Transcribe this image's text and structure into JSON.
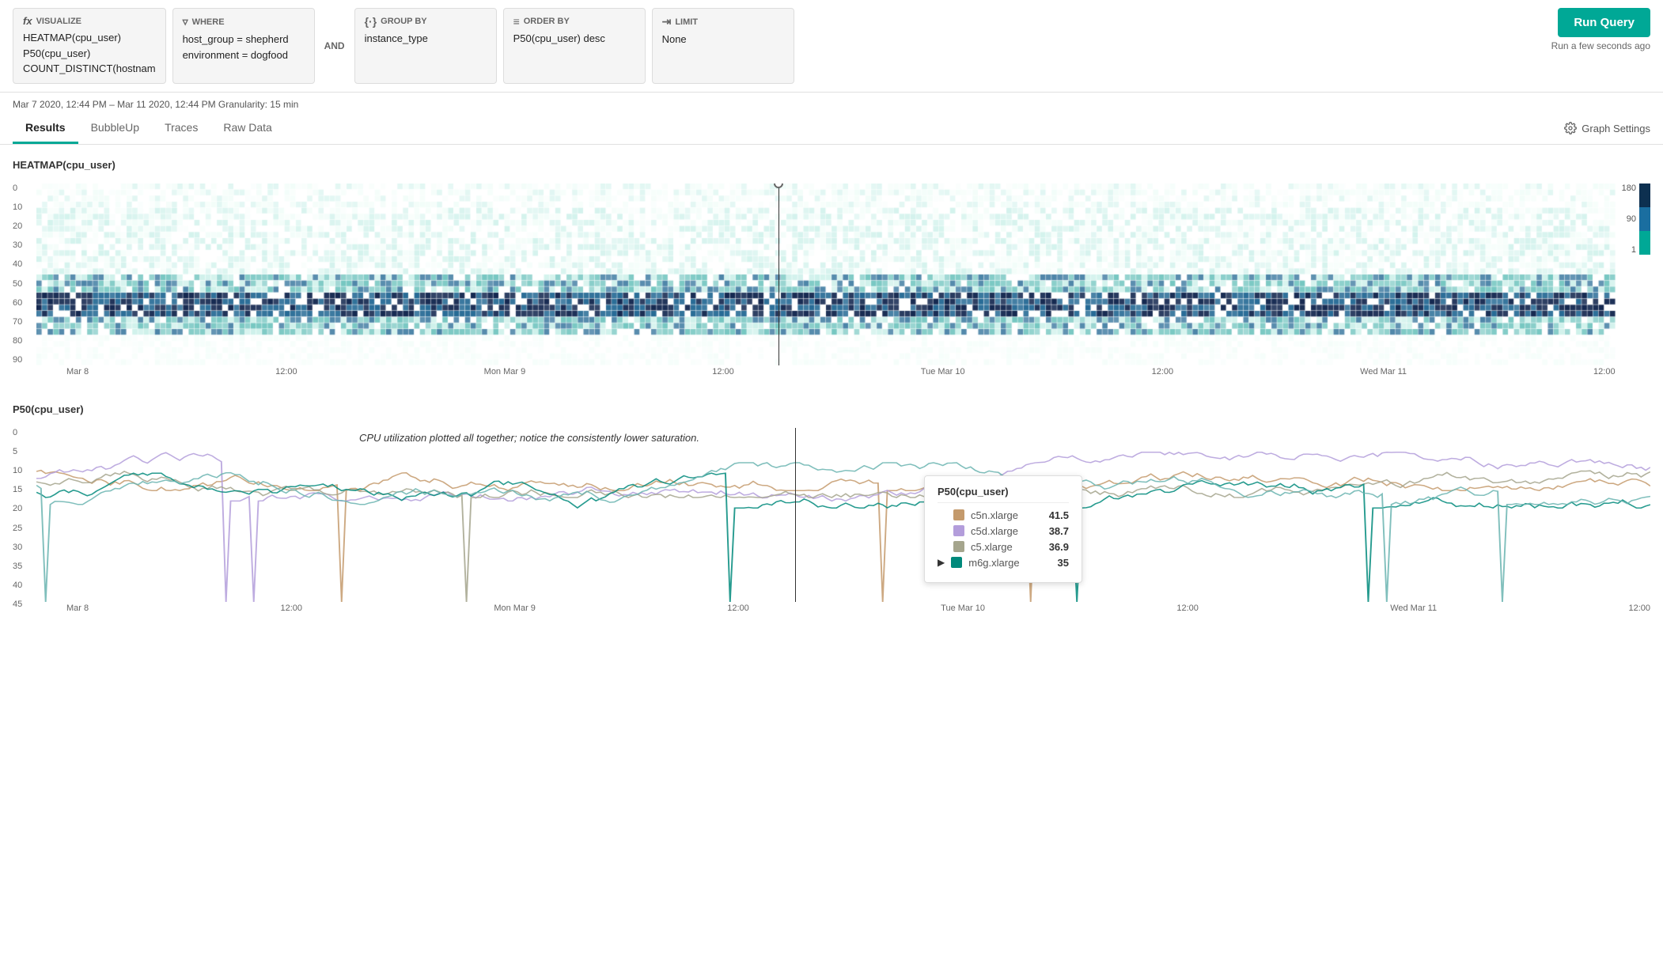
{
  "topbar": {
    "visualize_label": "VISUALIZE",
    "visualize_content_line1": "HEATMAP(cpu_user)",
    "visualize_content_line2": "P50(cpu_user)",
    "visualize_content_line3": "COUNT_DISTINCT(hostnam",
    "where_label": "WHERE",
    "and_label": "AND",
    "where_content_line1": "host_group = shepherd",
    "where_content_line2": "environment = dogfood",
    "group_by_label": "GROUP BY",
    "group_by_content": "instance_type",
    "order_by_label": "ORDER BY",
    "order_by_content": "P50(cpu_user) desc",
    "limit_label": "LIMIT",
    "limit_content": "None",
    "run_button_label": "Run Query",
    "run_ago_label": "Run a few seconds ago"
  },
  "timerange": {
    "text": "Mar 7 2020, 12:44 PM – Mar 11 2020, 12:44 PM  Granularity: 15 min"
  },
  "tabs": [
    {
      "label": "Results",
      "active": true
    },
    {
      "label": "BubbleUp",
      "active": false
    },
    {
      "label": "Traces",
      "active": false
    },
    {
      "label": "Raw Data",
      "active": false
    }
  ],
  "graph_settings_label": "Graph Settings",
  "heatmap": {
    "title": "HEATMAP(cpu_user)",
    "y_axis": [
      "0",
      "10",
      "20",
      "30",
      "40",
      "50",
      "60",
      "70",
      "80",
      "90"
    ],
    "x_axis": [
      "Mar 8",
      "12:00",
      "Mon Mar 9",
      "12:00",
      "Tue Mar 10",
      "12:00",
      "Wed Mar 11",
      "12:00"
    ],
    "legend": {
      "max": "180",
      "mid": "90",
      "min": "1"
    }
  },
  "linechart": {
    "title": "P50(cpu_user)",
    "annotation": "CPU utilization plotted all together; notice the consistently lower saturation.",
    "y_axis": [
      "0",
      "5",
      "10",
      "15",
      "20",
      "25",
      "30",
      "35",
      "40",
      "45"
    ],
    "x_axis": [
      "Mar 8",
      "12:00",
      "Mon Mar 9",
      "12:00",
      "Tue Mar 10",
      "12:00",
      "Wed Mar 11",
      "12:00"
    ],
    "tooltip": {
      "title": "P50(cpu_user)",
      "rows": [
        {
          "name": "c5n.xlarge",
          "value": "41.5",
          "color": "#c49a6c"
        },
        {
          "name": "c5d.xlarge",
          "value": "38.7",
          "color": "#b39ddb"
        },
        {
          "name": "c5.xlarge",
          "value": "36.9",
          "color": "#a5a58d"
        },
        {
          "name": "m6g.xlarge",
          "value": "35",
          "color": "#00897b",
          "active": true
        }
      ]
    }
  }
}
